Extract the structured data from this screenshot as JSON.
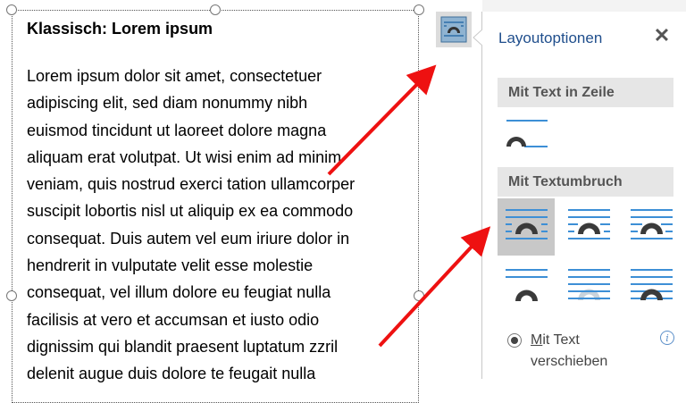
{
  "document": {
    "title": "Klassisch: Lorem ipsum",
    "lines": [
      "Lorem ipsum dolor sit amet, consectetuer",
      "adipiscing elit, sed diam nonummy nibh",
      "euismod tincidunt ut laoreet dolore magna",
      "aliquam erat volutpat. Ut wisi enim ad minim",
      "veniam, quis nostrud exerci tation ullamcorper",
      "suscipit lobortis nisl ut aliquip ex ea commodo",
      "consequat. Duis autem vel eum iriure dolor in",
      "hendrerit in vulputate velit esse molestie",
      "consequat, vel illum dolore eu feugiat nulla",
      "facilisis at vero et accumsan et iusto odio",
      "dignissim qui blandit praesent luptatum zzril",
      "delenit augue duis dolore te feugait nulla"
    ]
  },
  "layout_button": {
    "icon": "wrap-square-icon"
  },
  "panel": {
    "title": "Layoutoptionen",
    "close_icon": "close-icon",
    "section_inline": "Mit Text in Zeile",
    "section_wrap": "Mit Textumbruch",
    "inline_option": "inline-with-text-icon",
    "wrap_options": [
      "wrap-square-icon",
      "wrap-tight-icon",
      "wrap-through-icon",
      "wrap-top-bottom-icon",
      "wrap-behind-text-icon",
      "wrap-in-front-icon"
    ],
    "selected_wrap": "wrap-square-icon",
    "radio_label_underlined": "M",
    "radio_label_rest": "it Text",
    "radio_label_line2": "verschieben",
    "info_icon": "i",
    "colors": {
      "line_blue": "#3d8fd6",
      "shape_dark": "#3a3a3a",
      "selected_bg": "#c8c8c8",
      "arrow_red": "#ee1111"
    }
  }
}
